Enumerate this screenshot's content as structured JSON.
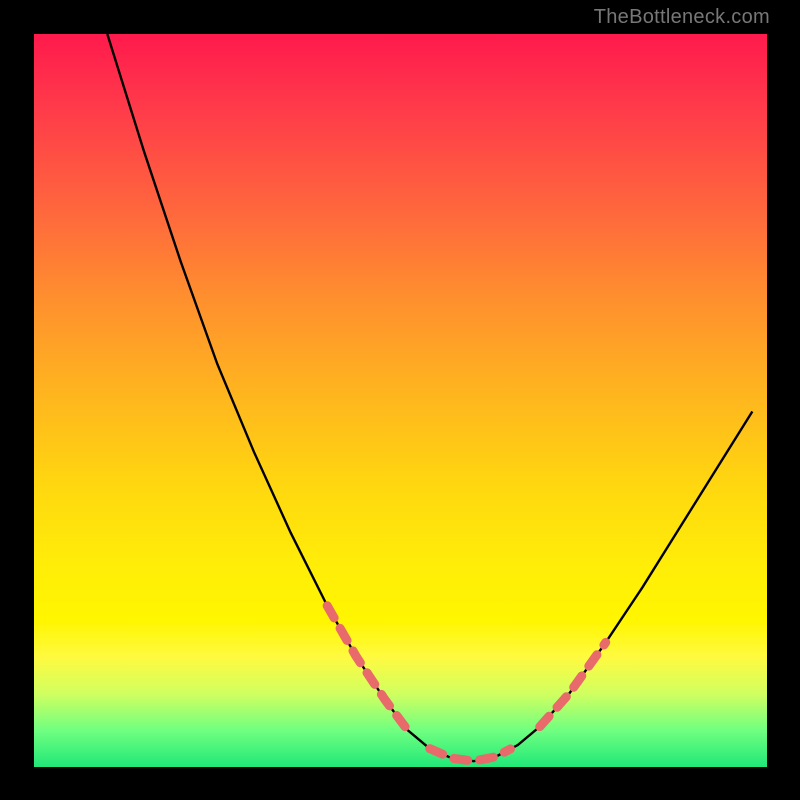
{
  "watermark": "TheBottleneck.com",
  "colors": {
    "background": "#000000",
    "curve_stroke": "#000000",
    "dash_stroke": "#e86a6a"
  },
  "chart_data": {
    "type": "line",
    "title": "",
    "xlabel": "",
    "ylabel": "",
    "xlim": [
      0,
      100
    ],
    "ylim": [
      0,
      100
    ],
    "series": [
      {
        "name": "curve",
        "x": [
          10,
          15,
          20,
          25,
          30,
          35,
          40,
          44,
          48,
          51,
          54,
          57,
          60,
          63,
          66,
          69,
          73,
          78,
          83,
          88,
          93,
          98
        ],
        "values": [
          100,
          84,
          69,
          55,
          43,
          32,
          22,
          15,
          9,
          5,
          2.5,
          1.2,
          0.8,
          1.4,
          3,
          5.5,
          10,
          17,
          24.5,
          32.5,
          40.5,
          48.5
        ]
      }
    ],
    "dashed_segments": [
      {
        "x_start": 40,
        "x_end": 51,
        "use_series": "curve"
      },
      {
        "x_start": 54,
        "x_end": 65,
        "use_series": "curve"
      },
      {
        "x_start": 69,
        "x_end": 78,
        "use_series": "curve"
      }
    ]
  }
}
